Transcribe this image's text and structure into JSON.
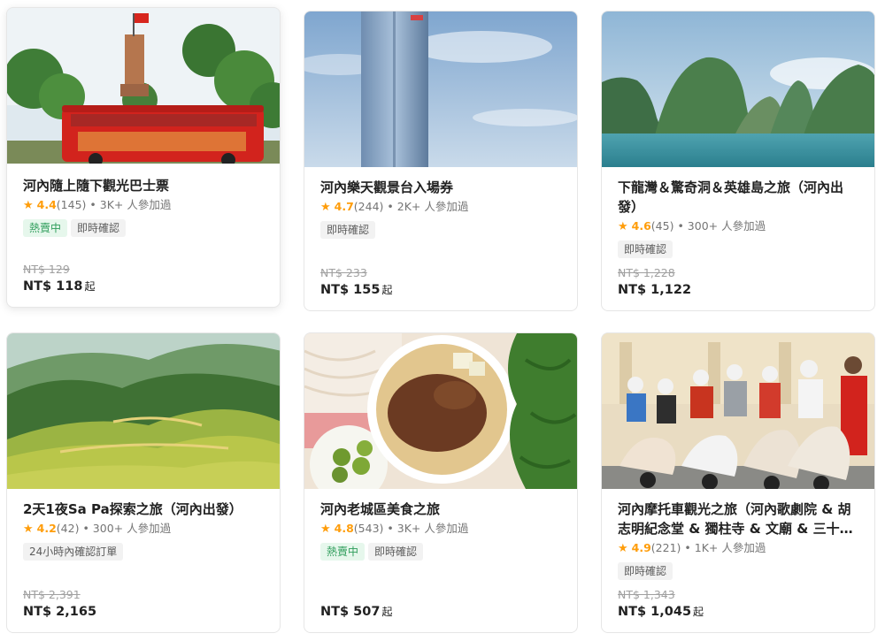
{
  "cards": [
    {
      "title": "河內隨上隨下觀光巴士票",
      "rating": "4.4",
      "reviews": "(145)",
      "participants": "• 3K+ 人參加過",
      "tags": [
        "熱賣中",
        "即時確認"
      ],
      "old_price": "NT$ 129",
      "price": "NT$ 118",
      "price_suffix": "起",
      "image_alt": "河內旗塔與紅色觀光巴士"
    },
    {
      "title": "河內樂天觀景台入場券",
      "rating": "4.7",
      "reviews": "(244)",
      "participants": "• 2K+ 人參加過",
      "tags": [
        "即時確認"
      ],
      "old_price": "NT$ 233",
      "price": "NT$ 155",
      "price_suffix": "起",
      "image_alt": "河內樂天中心大樓"
    },
    {
      "title": "下龍灣＆驚奇洞＆英雄島之旅（河內出發）",
      "rating": "4.6",
      "reviews": "(45)",
      "participants": "• 300+ 人參加過",
      "tags": [
        "即時確認"
      ],
      "old_price": "NT$ 1,228",
      "price": "NT$ 1,122",
      "price_suffix": "",
      "image_alt": "下龍灣石灰岩島嶼"
    },
    {
      "title": "2天1夜Sa Pa探索之旅（河內出發）",
      "rating": "4.2",
      "reviews": "(42)",
      "participants": "• 300+ 人參加過",
      "tags": [
        "24小時內確認訂單"
      ],
      "old_price": "NT$ 2,391",
      "price": "NT$ 2,165",
      "price_suffix": "",
      "image_alt": "沙壩梯田"
    },
    {
      "title": "河內老城區美食之旅",
      "rating": "4.8",
      "reviews": "(543)",
      "participants": "• 3K+ 人參加過",
      "tags": [
        "熱賣中",
        "即時確認"
      ],
      "old_price": "",
      "price": "NT$ 507",
      "price_suffix": "起",
      "image_alt": "越南烤肉米線"
    },
    {
      "title": "河內摩托車觀光之旅（河內歌劇院 & 胡志明紀念堂 & 獨柱寺 & 文廟 & 三十…",
      "rating": "4.9",
      "reviews": "(221)",
      "participants": "• 1K+ 人參加過",
      "tags": [
        "即時確認"
      ],
      "old_price": "NT$ 1,343",
      "price": "NT$ 1,045",
      "price_suffix": "起",
      "image_alt": "河內歌劇院前的摩托車遊客"
    }
  ],
  "ui": {
    "star_glyph": "★",
    "hot_tag": "熱賣中",
    "colors": {
      "star": "#ff9d0a",
      "hot_bg": "#e6f7ec",
      "hot_text": "#2f9d5b",
      "tag_bg": "#f2f2f2"
    }
  }
}
